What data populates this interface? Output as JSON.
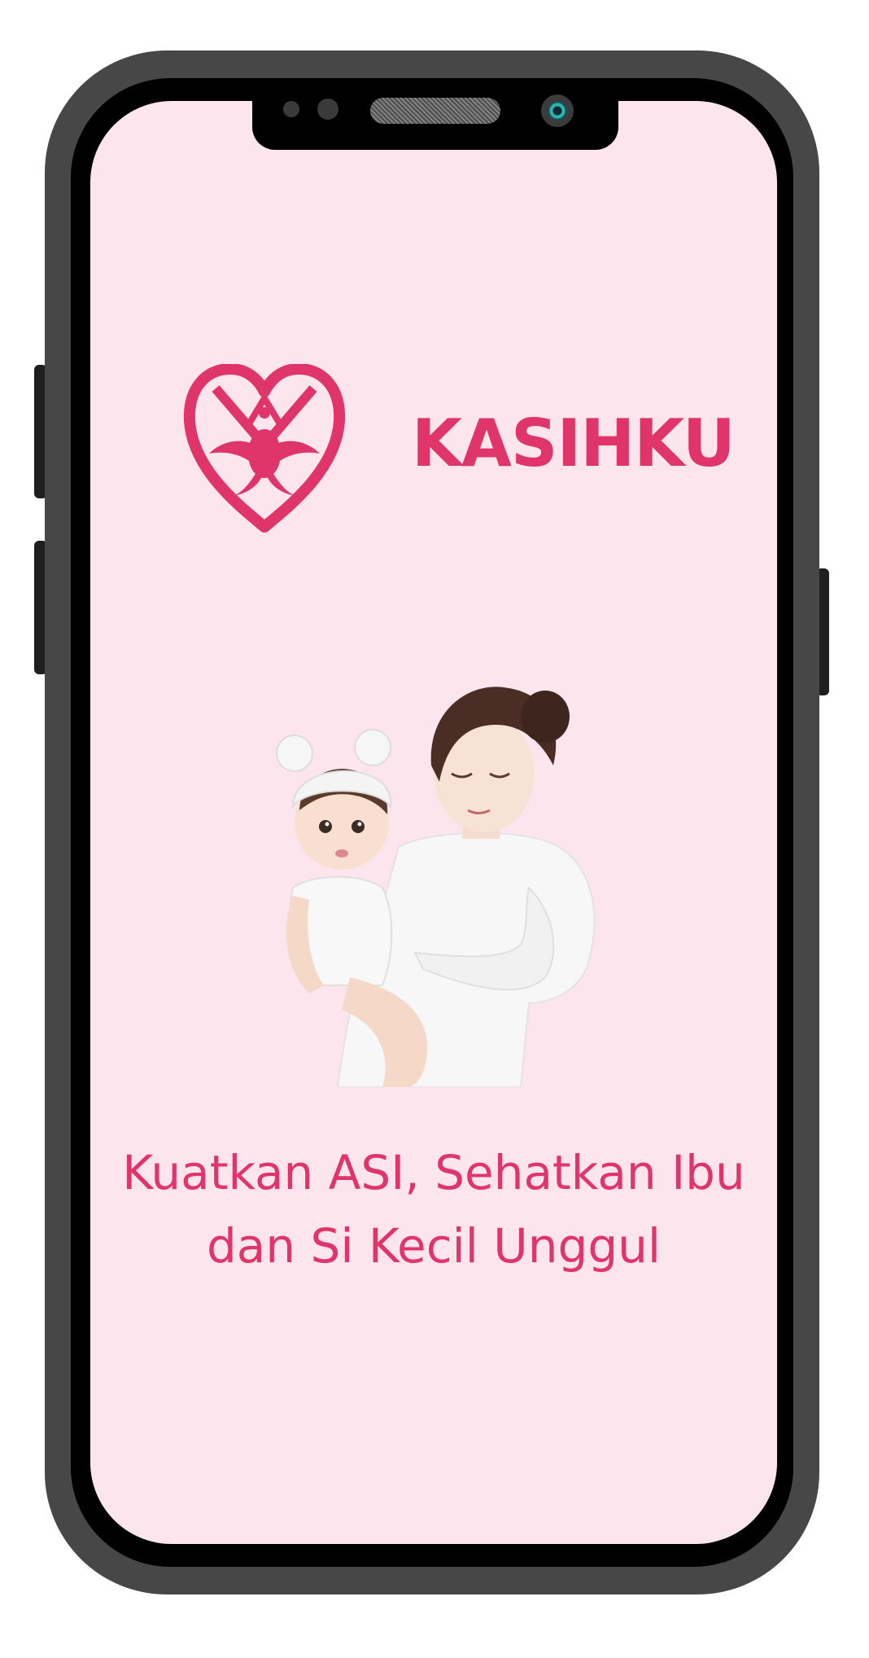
{
  "app": {
    "brand_name": "KASIHKU",
    "tagline_line1": "Kuatkan ASI, Sehatkan Ibu",
    "tagline_line2": "dan Si Kecil Unggul"
  },
  "colors": {
    "brand_pink": "#e0356a",
    "screen_background": "#fde5ee",
    "phone_frame": "#474747"
  },
  "icons": {
    "logo": "heart-with-mother-child-emblem",
    "illustration": "mother-holding-baby"
  }
}
